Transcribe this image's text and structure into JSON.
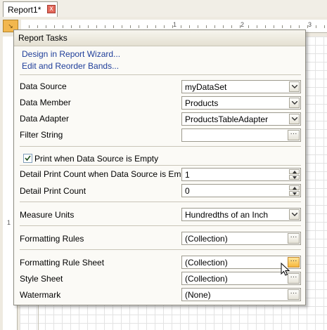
{
  "tab": {
    "label": "Report1*",
    "close_glyph": "x"
  },
  "ruler": {
    "n1": "1",
    "n2": "2",
    "n3": "3",
    "v1": "1"
  },
  "corner_glyph": "↘",
  "panel": {
    "title": "Report Tasks",
    "links": [
      {
        "label": "Design in Report Wizard..."
      },
      {
        "label": "Edit and Reorder Bands..."
      }
    ],
    "data_source": {
      "label": "Data Source",
      "value": "myDataSet"
    },
    "data_member": {
      "label": "Data Member",
      "value": "Products"
    },
    "data_adapter": {
      "label": "Data Adapter",
      "value": "ProductsTableAdapter"
    },
    "filter_string": {
      "label": "Filter String",
      "value": ""
    },
    "print_when_empty": {
      "label": "Print when Data Source is Empty",
      "checked": true
    },
    "detail_count_empty": {
      "label": "Detail Print Count when Data Source is Empty",
      "value": "1"
    },
    "detail_count": {
      "label": "Detail Print Count",
      "value": "0"
    },
    "measure_units": {
      "label": "Measure Units",
      "value": "Hundredths of an Inch"
    },
    "formatting_rules": {
      "label": "Formatting Rules",
      "value": "(Collection)"
    },
    "formatting_rule_sheet": {
      "label": "Formatting Rule Sheet",
      "value": "(Collection)"
    },
    "style_sheet": {
      "label": "Style Sheet",
      "value": "(Collection)"
    },
    "watermark": {
      "label": "Watermark",
      "value": "(None)"
    },
    "ellipsis": "···"
  },
  "colors": {
    "link": "#1f3e9a",
    "hot_button": "#f6b73c",
    "tab_close": "#e46a5c"
  }
}
